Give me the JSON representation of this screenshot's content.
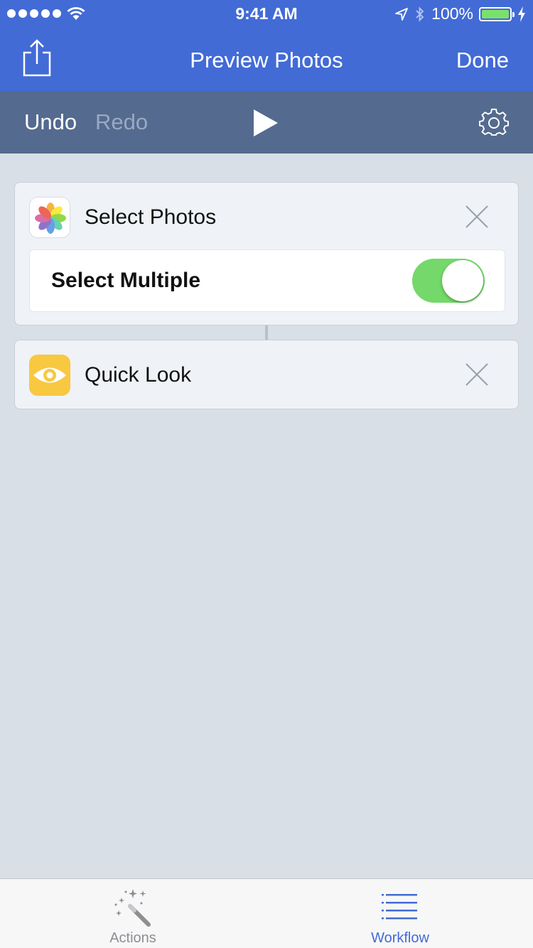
{
  "status_bar": {
    "time": "9:41 AM",
    "battery_percent": "100%",
    "battery_level": 1.0,
    "signal_bars": 5
  },
  "nav_bar": {
    "title": "Preview Photos",
    "done_label": "Done",
    "share_icon": "share-icon"
  },
  "toolbar": {
    "undo_label": "Undo",
    "redo_label": "Redo",
    "play_icon": "play-icon",
    "settings_icon": "gear-icon"
  },
  "workflow": {
    "actions": [
      {
        "title": "Select Photos",
        "icon": "photos-icon",
        "options": [
          {
            "label": "Select Multiple",
            "enabled": true
          }
        ]
      },
      {
        "title": "Quick Look",
        "icon": "eye-icon",
        "options": []
      }
    ]
  },
  "tab_bar": {
    "tabs": [
      {
        "label": "Actions",
        "icon": "magic-wand-icon",
        "selected": false
      },
      {
        "label": "Workflow",
        "icon": "list-icon",
        "selected": true
      }
    ]
  },
  "colors": {
    "nav_blue": "#436bd6",
    "toolbar_slate": "#546a8f",
    "background": "#d9dfe7",
    "toggle_on": "#74d86a",
    "quick_look_yellow": "#f8c841",
    "tab_selected": "#436bd6",
    "tab_unselected": "#8e8e93"
  }
}
